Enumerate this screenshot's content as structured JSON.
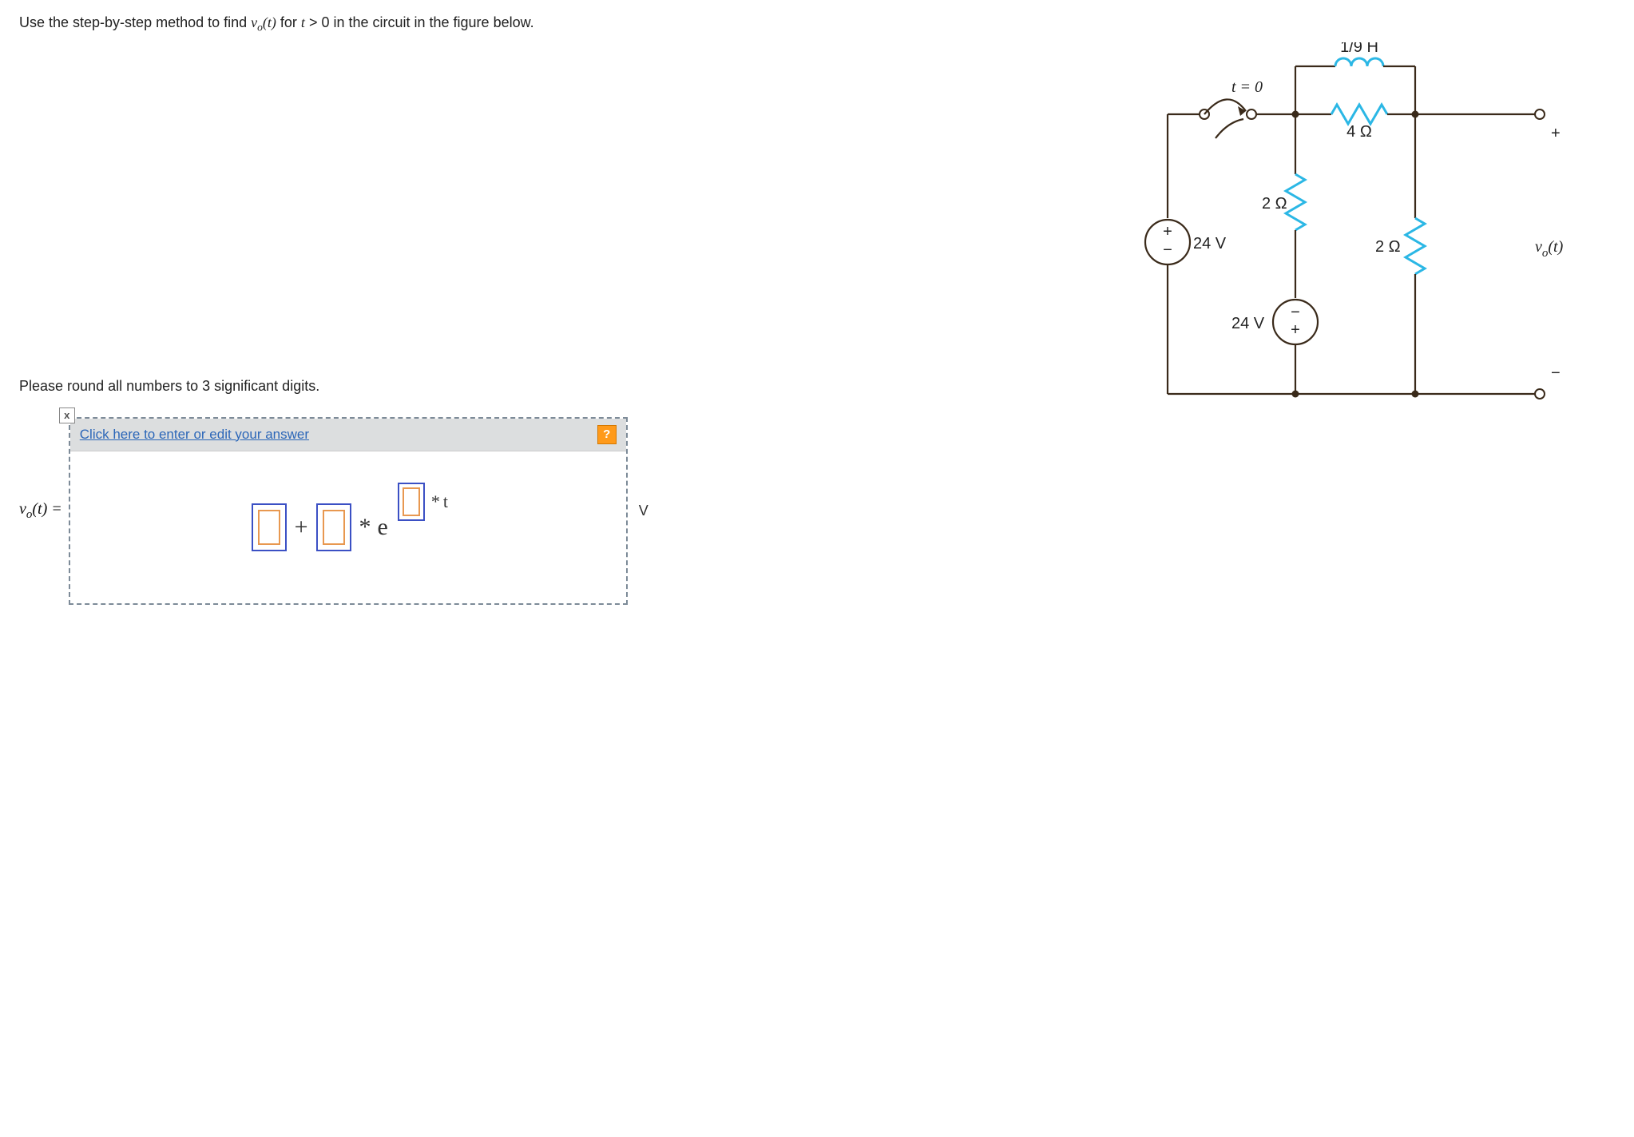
{
  "question": {
    "prefix": "Use the step-by-step method to find ",
    "var": "v",
    "sub": "o",
    "arg": "(t)",
    "mid": " for ",
    "cond_var": "t",
    "cond": " > 0 in the circuit in the figure below."
  },
  "circuit": {
    "inductor_label": "1/9 H",
    "switch_label": "t = 0",
    "r_top": "4 Ω",
    "r_left_branch": "2 Ω",
    "r_right_branch": "2 Ω",
    "vs_left": "24 V",
    "vs_mid": "24 V",
    "vo_var": "v",
    "vo_sub": "o",
    "vo_arg": "(t)",
    "plus": "+",
    "minus": "−"
  },
  "instructions": "Please round all numbers to 3 significant digits.",
  "answer_box": {
    "header_link": "Click here to enter or edit your answer",
    "help": "?",
    "close": "x",
    "label_var": "v",
    "label_sub": "o",
    "label_arg": "(t) =",
    "plus": "+",
    "times": "*",
    "e": "e",
    "exp_times": "*",
    "exp_t": "t",
    "unit": "V"
  }
}
